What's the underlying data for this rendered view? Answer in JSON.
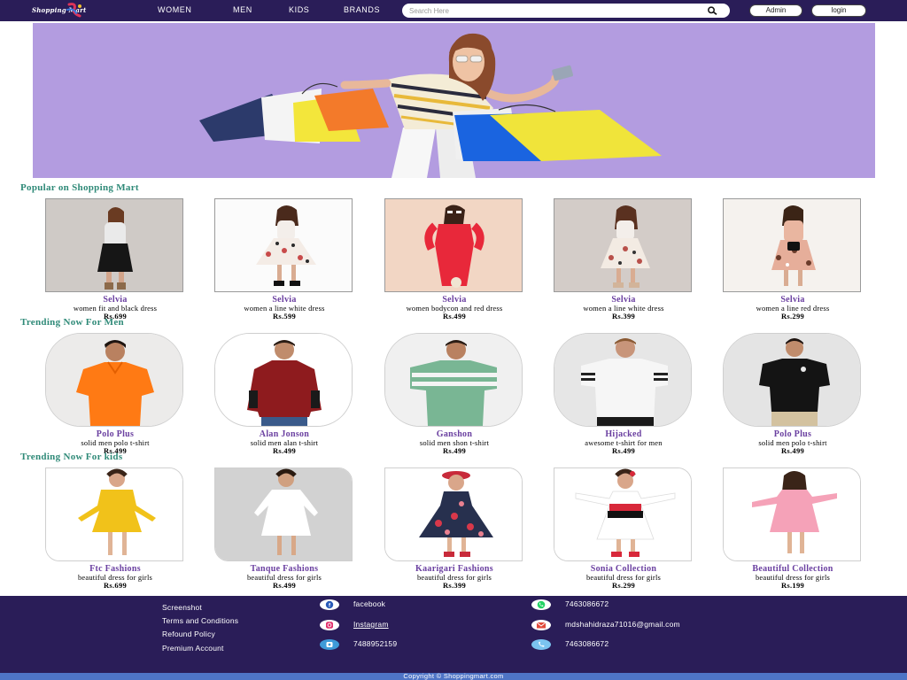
{
  "brand": {
    "logo_text": "Shopping Mart"
  },
  "nav": {
    "links": [
      "WOMEN",
      "MEN",
      "KIDS",
      "BRANDS"
    ],
    "search_placeholder": "Search Here",
    "admin_label": "Admin",
    "login_label": "login"
  },
  "sections": [
    {
      "title": "Popular on Shopping Mart",
      "items": [
        {
          "brand": "Selvia",
          "desc": "women fit and black dress",
          "price": "Rs.699"
        },
        {
          "brand": "Selvia",
          "desc": "women a line white dress",
          "price": "Rs.599"
        },
        {
          "brand": "Selvia",
          "desc": "women bodycon and red dress",
          "price": "Rs.499"
        },
        {
          "brand": "Selvia",
          "desc": "women a line white dress",
          "price": "Rs.399"
        },
        {
          "brand": "Selvia",
          "desc": "women a line red dress",
          "price": "Rs.299"
        }
      ]
    },
    {
      "title": "Trending Now For Men",
      "items": [
        {
          "brand": "Polo Plus",
          "desc": "solid men polo t-shirt",
          "price": "Rs.499"
        },
        {
          "brand": "Alan Jonson",
          "desc": "solid men alan t-shirt",
          "price": "Rs.499"
        },
        {
          "brand": "Ganshon",
          "desc": "solid men shon t-shirt",
          "price": "Rs.499"
        },
        {
          "brand": "Hijacked",
          "desc": "awesome t-shirt for men",
          "price": "Rs.499"
        },
        {
          "brand": "Polo Plus",
          "desc": "solid men polo t-shirt",
          "price": "Rs.499"
        }
      ]
    },
    {
      "title": "Trending Now For kids",
      "items": [
        {
          "brand": "Ftc Fashions",
          "desc": "beautiful dress for girls",
          "price": "Rs.699"
        },
        {
          "brand": "Tanque Fashions",
          "desc": "beautiful dress for girls",
          "price": "Rs.499"
        },
        {
          "brand": "Kaarigari Fashions",
          "desc": "beautiful dress for girls",
          "price": "Rs.399"
        },
        {
          "brand": "Sonia Collection",
          "desc": "beautiful dress for girls",
          "price": "Rs.299"
        },
        {
          "brand": "Beautiful Collection",
          "desc": "beautiful dress for girls",
          "price": "Rs.199"
        }
      ]
    }
  ],
  "footer": {
    "links": [
      "Screenshot",
      "Terms and Conditions",
      "Refound Policy",
      "Premium Account"
    ],
    "social": [
      {
        "icon": "facebook-icon",
        "label": "facebook"
      },
      {
        "icon": "instagram-icon",
        "label": "Instagram"
      },
      {
        "icon": "phone-icon",
        "label": "7488952159"
      }
    ],
    "contact": [
      {
        "icon": "whatsapp-icon",
        "label": "7463086672"
      },
      {
        "icon": "email-icon",
        "label": "mdshahidraza71016@gmail.com"
      },
      {
        "icon": "call-icon",
        "label": "7463086672"
      }
    ],
    "copyright": "Copyright © Shoppingmart.com"
  },
  "colors": {
    "nav_bg": "#2a1d58",
    "hero_bg": "#b39ce0",
    "section_title": "#2f8a78",
    "brand_name": "#6a3fa0",
    "copyright_bar": "#4e74c6"
  }
}
